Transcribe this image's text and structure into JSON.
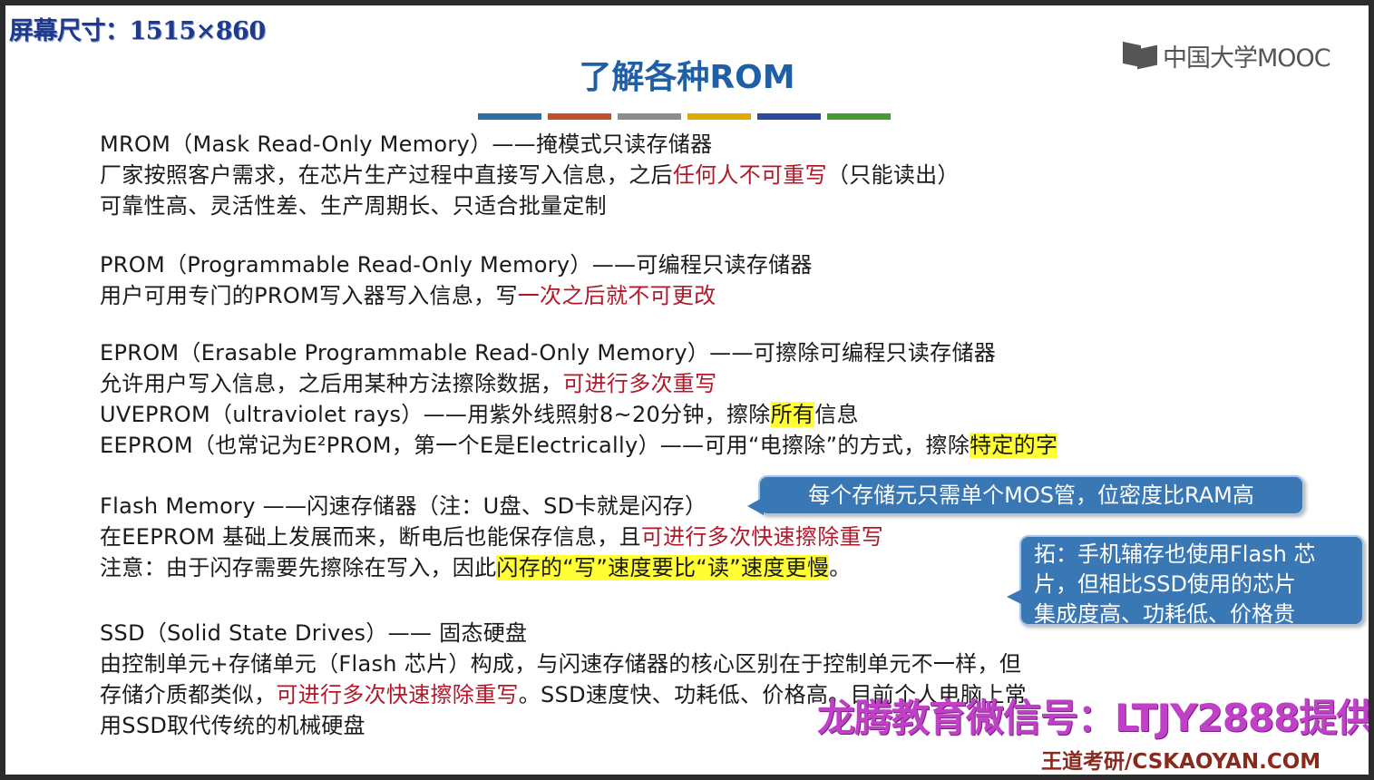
{
  "screen_size_label": "屏幕尺寸：1515×860",
  "logo_text": "中国大学MOOC",
  "title": "了解各种ROM",
  "color_bar": [
    "#2e6fa8",
    "#c0502a",
    "#8c8c8c",
    "#e0a800",
    "#2a4aa0",
    "#4a9a32"
  ],
  "sections": {
    "mrom": {
      "heading": "MROM（Mask Read-Only Memory）——掩模式只读存储器",
      "l1a": "厂家按照客户需求，在芯片生产过程中直接写入信息，之后",
      "l1b": "任何人不可重写",
      "l1c": "（只能读出）",
      "l2": "可靠性高、灵活性差、生产周期长、只适合批量定制"
    },
    "prom": {
      "heading": "PROM（Programmable Read-Only Memory）——可编程只读存储器",
      "l1a": "用户可用专门的PROM写入器写入信息，写",
      "l1b": "一次之后就不可更改"
    },
    "eprom": {
      "heading": "EPROM（Erasable Programmable Read-Only Memory）——可擦除可编程只读存储器",
      "l1a": "允许用户写入信息，之后用某种方法擦除数据，",
      "l1b": "可进行多次重写",
      "uv_a": "UVEPROM（ultraviolet rays）——用紫外线照射8~20分钟，擦除",
      "uv_b": "所有",
      "uv_c": "信息",
      "ee_a": "EEPROM（也常记为E²PROM，第一个E是Electrically）——可用“电擦除”的方式，擦除",
      "ee_b": "特定的字"
    },
    "flash": {
      "heading": "Flash Memory ——闪速存储器（注：U盘、SD卡就是闪存）",
      "l1a": "在EEPROM 基础上发展而来，断电后也能保存信息，且",
      "l1b": "可进行多次快速擦除重写",
      "l2a": "注意：由于闪存需要先擦除在写入，因此",
      "l2b": "闪存的“写”速度要比“读”速度更慢",
      "l2c": "。"
    },
    "ssd": {
      "heading": "SSD（Solid State Drives）—— 固态硬盘",
      "l1": "由控制单元+存储单元（Flash 芯片）构成，与闪速存储器的核心区别在于控制单元不一样，但",
      "l2a": "存储介质都类似，",
      "l2b": "可进行多次快速擦除重写",
      "l2c": "。SSD速度快、功耗低、价格高。目前个人电脑上常",
      "l3": "用SSD取代传统的机械硬盘"
    }
  },
  "callouts": {
    "mos": "每个存储元只需单个MOS管，位密度比RAM高",
    "ext_l1": "拓：手机辅存也使用Flash 芯",
    "ext_l2": "片，但相比SSD使用的芯片",
    "ext_l3": "集成度高、功耗低、价格贵"
  },
  "watermark": "龙腾教育微信号：LTJY2888提供",
  "footer": "王道考研/CSKAOYAN.COM"
}
